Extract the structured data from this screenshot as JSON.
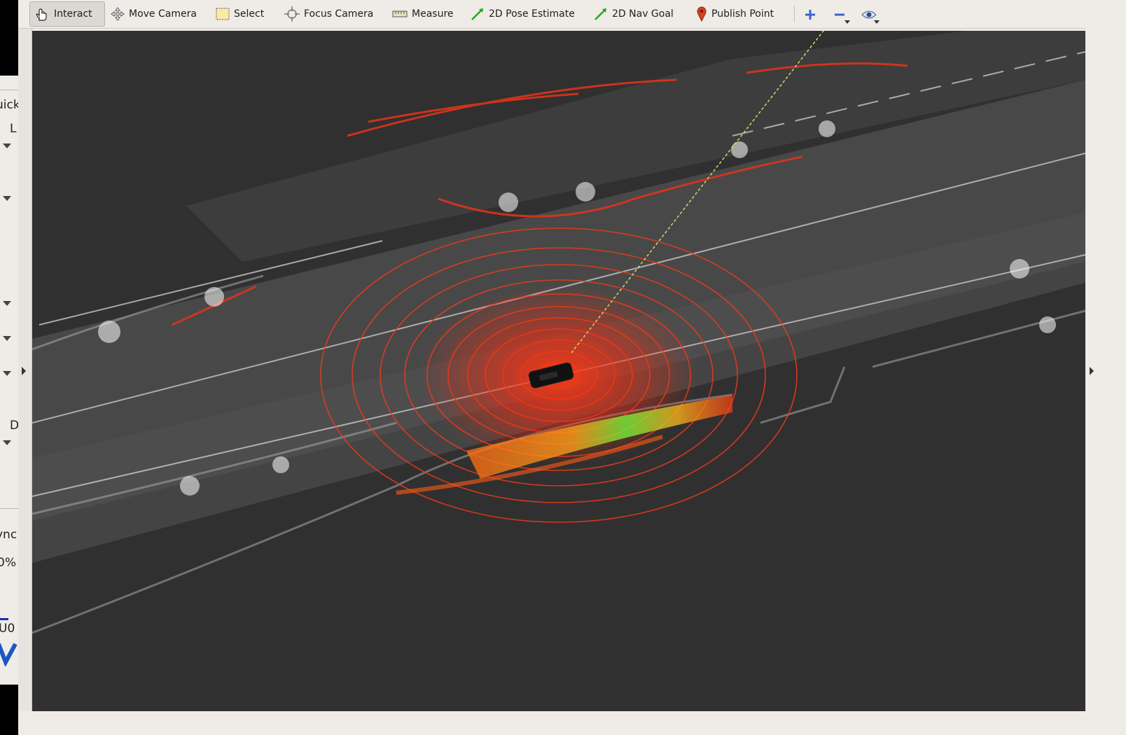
{
  "toolbar": {
    "tools": [
      {
        "label": "Interact",
        "icon": "hand-cursor-icon",
        "active": true
      },
      {
        "label": "Move Camera",
        "icon": "move-arrows-icon"
      },
      {
        "label": "Select",
        "icon": "selection-box-icon"
      },
      {
        "label": "Focus Camera",
        "icon": "crosshair-icon"
      },
      {
        "label": "Measure",
        "icon": "ruler-icon"
      },
      {
        "label": "2D Pose Estimate",
        "icon": "green-arrow-icon"
      },
      {
        "label": "2D Nav Goal",
        "icon": "green-arrow-icon"
      },
      {
        "label": "Publish Point",
        "icon": "map-pin-icon"
      }
    ],
    "extra_icons": [
      "plus-icon",
      "minus-icon",
      "eye-icon"
    ]
  },
  "left_panel": {
    "fragments": [
      "uick",
      "L",
      "D",
      "ync",
      "0%",
      "U0"
    ]
  },
  "colors": {
    "viewport_background": "#303030",
    "scan_red": "#e8331a",
    "ground_grey": "#9a9a9a",
    "highlight_green": "#6ef03a",
    "highlight_orange": "#ff8a1a",
    "toolbar_background": "#efebe7"
  }
}
